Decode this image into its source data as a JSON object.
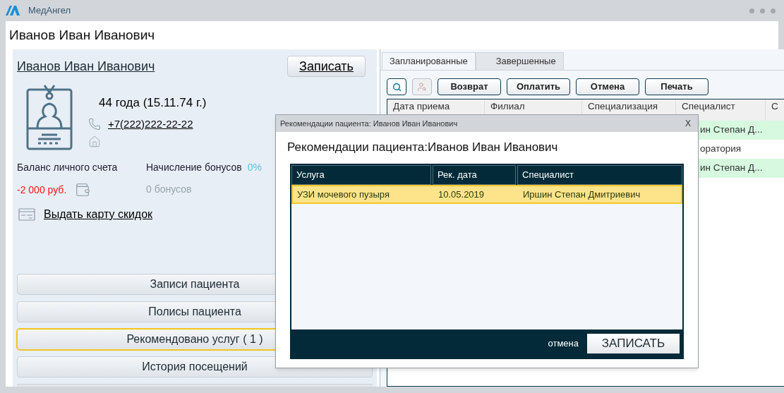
{
  "app": {
    "name": "МедАнгел"
  },
  "page_title": "Иванов Иван Иванович",
  "patient": {
    "name": "Иванов Иван Иванович",
    "book_button": "Записать",
    "age": "44 года  (15.11.74 г.)",
    "phone": "+7(222)222-22-22",
    "balance_label": "Баланс личного счета",
    "balance": "-2 000 руб.",
    "bonus_label": "Начисление бонусов",
    "bonus_rate": "0%",
    "bonus_amount": "0 бонусов",
    "discount_card_link": "Выдать карту скидок"
  },
  "sections": [
    {
      "label": "Записи пациента",
      "selected": false
    },
    {
      "label": "Полисы пациента",
      "selected": false
    },
    {
      "label": "Рекомендовано услуг ( 1 )",
      "selected": true
    },
    {
      "label": "История посещений",
      "selected": false
    }
  ],
  "tabs": [
    {
      "label": "Запланированные",
      "selected": true
    },
    {
      "label": "Завершенные",
      "selected": false
    }
  ],
  "toolbar": {
    "search_disabled": false,
    "patient_search_disabled": true,
    "buttons": [
      "Возврат",
      "Оплатить",
      "Отмена",
      "Печать"
    ]
  },
  "table": {
    "columns": [
      "Дата приема",
      "Филиал",
      "Специализация",
      "Специалист",
      "С"
    ],
    "rows": [
      {
        "column_4": "ин Степан Д...",
        "highlighted": true
      },
      {
        "column_4": "оратория",
        "highlighted": false
      },
      {
        "column_4": "ин Степан Д...",
        "highlighted": true
      }
    ]
  },
  "dialog": {
    "title": "Рекомендации пациента: Иванов Иван Иванович",
    "close": "X",
    "heading": "Рекомендации пациента:Иванов Иван Иванович",
    "columns": [
      "Услуга",
      "Рек. дата",
      "Специалист"
    ],
    "rows": [
      {
        "service": "УЗИ мочевого пузыря",
        "date": "10.05.2019",
        "specialist": "Иршин Степан Дмитриевич",
        "selected": true
      }
    ],
    "cancel": "отмена",
    "submit": "ЗАПИСАТЬ"
  }
}
